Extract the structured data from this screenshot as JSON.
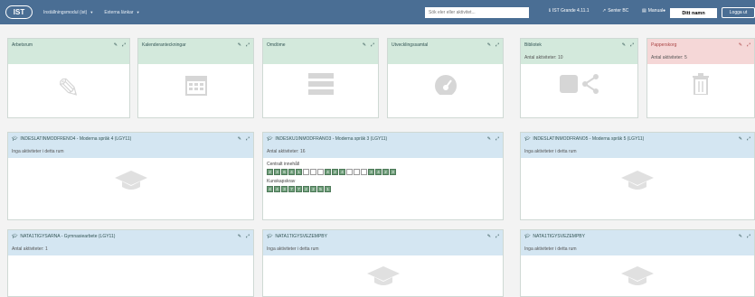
{
  "topbar": {
    "logo": "IST",
    "nav": [
      {
        "label": "Inställningsmodul (ist)"
      },
      {
        "label": "Externa länkar"
      }
    ],
    "search_placeholder": "Sök eler eller aktivitet...",
    "items": [
      {
        "label": "IST Grande 4.11.1"
      },
      {
        "label": "Senter BC"
      },
      {
        "label": "Manual"
      }
    ],
    "user_name": "Ditt namn",
    "logout_label": "Logga ut"
  },
  "widgets": [
    {
      "title": "Arbetsrum",
      "sub": "",
      "theme": "green",
      "icon": "wrench-icon"
    },
    {
      "title": "Kalenderanteckningar",
      "sub": "",
      "theme": "green",
      "icon": "calendar-icon"
    },
    {
      "title": "Omdöme",
      "sub": "",
      "theme": "green",
      "icon": "list-icon"
    },
    {
      "title": "Utvecklingssamtal",
      "sub": "",
      "theme": "green",
      "icon": "dashboard-icon"
    },
    {
      "title": "Bibliotek",
      "sub": "Antal aktiviteter: 10",
      "theme": "green",
      "icon": "share-icon"
    },
    {
      "title": "Papperskorg",
      "sub": "Antal aktiviteter: 5",
      "theme": "pink",
      "icon": "trash-icon"
    }
  ],
  "courses": [
    {
      "title": "INDESLATINMODFRENO4 - Moderna språk 4 (LGY11)",
      "sub": "Inga aktiviteter i detta rum",
      "content": "empty"
    },
    {
      "title": "INDESKU1INMODFRANO3 - Moderna språk 3 (LGY11)",
      "sub": "Antal aktiviteter: 16",
      "content": "grades"
    },
    {
      "title": "INDESLATINMODFRANO5 - Moderna språk 5 (LGY11)",
      "sub": "Inga aktiviteter i detta rum",
      "content": "empty"
    },
    {
      "title": "NATA1TIGYSARNA - Gymnasiearbete (LGY11)",
      "sub": "Antal aktiviteter: 1",
      "content": "none"
    },
    {
      "title": "NATA1TIGYSVEZEMPBY",
      "sub": "Inga aktiviteter i detta rum",
      "content": "empty"
    },
    {
      "title": "NATA1TIGYSVEZEMPBY",
      "sub": "Inga aktiviteter i detta rum",
      "content": "empty"
    }
  ],
  "grades": {
    "central_label": "Centralt innehåll",
    "central_boxes": [
      "2",
      "3",
      "6",
      "4",
      "1",
      "",
      "",
      "",
      "4",
      "2",
      "4",
      "",
      "",
      "",
      "3",
      "4",
      "2",
      "3"
    ],
    "criteria_label": "Kunskapskrav",
    "criteria_boxes": [
      "4",
      "4",
      "3",
      "7",
      "7",
      "2",
      "2",
      "5",
      "1"
    ]
  }
}
